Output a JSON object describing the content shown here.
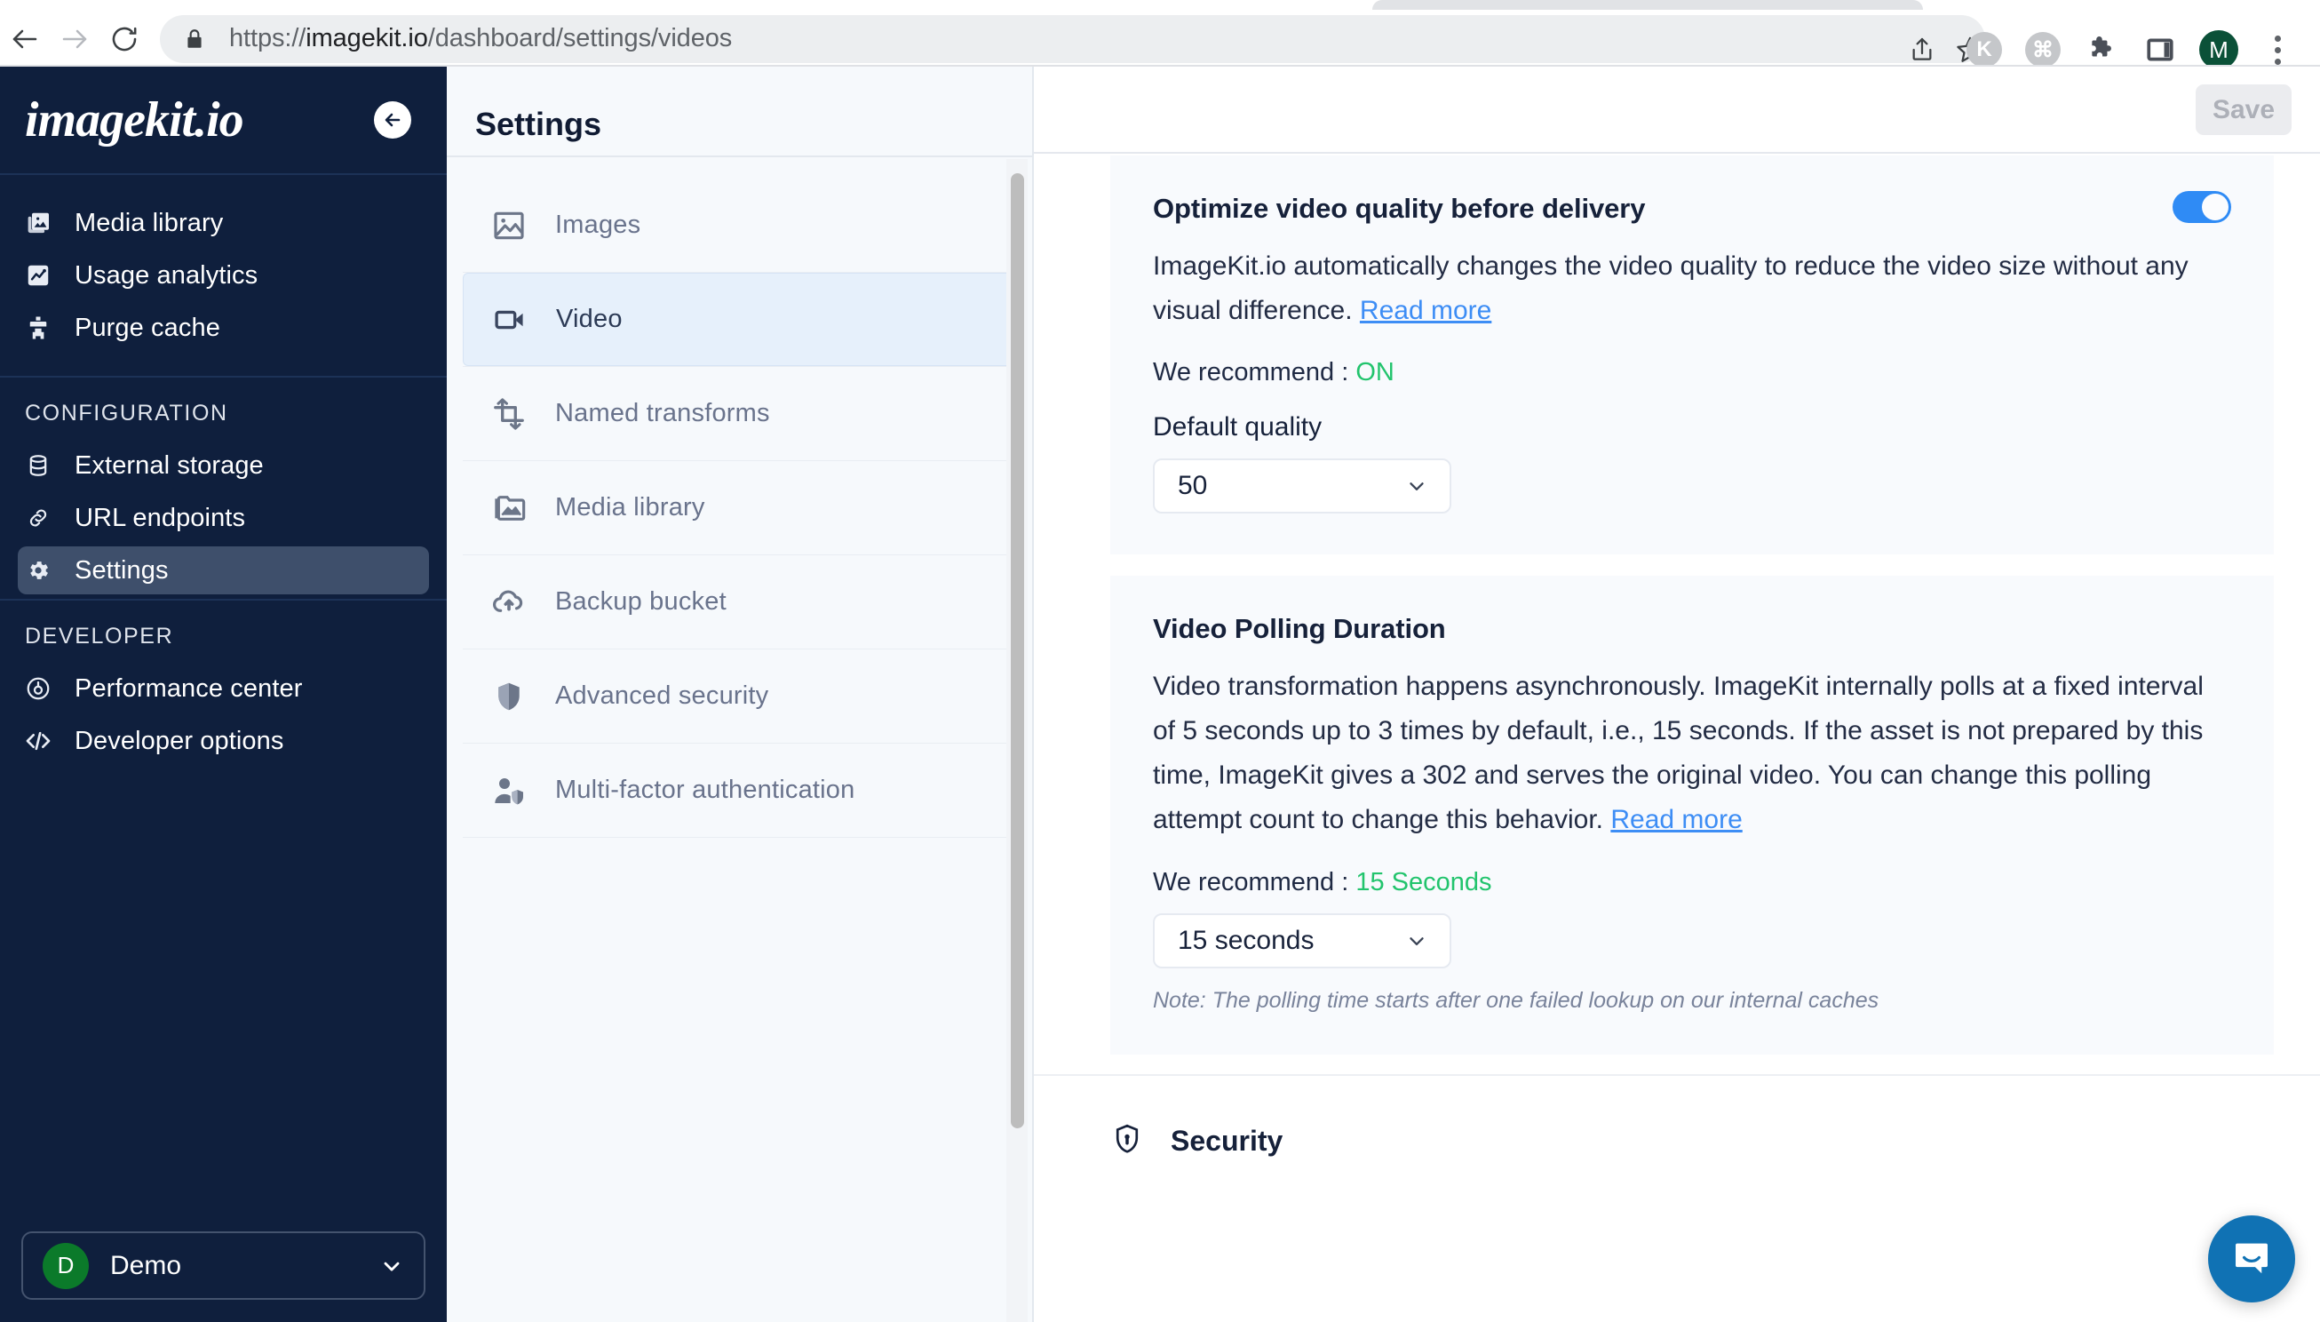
{
  "browser": {
    "back_label": "Back",
    "forward_label": "Forward",
    "reload_label": "Reload",
    "url_secure_part": "https://",
    "url_domain": "imagekit.io",
    "url_path": "/dashboard/settings/videos",
    "url_full": "https://imagekit.io/dashboard/settings/videos",
    "share_label": "Share",
    "bookmark_label": "Bookmark",
    "ext_k_label": "K",
    "ext_cmd_label": "⌘",
    "extensions_label": "Extensions",
    "side_panel_label": "Side panel",
    "profile_initial": "M",
    "menu_label": "Customize and control"
  },
  "sidebar": {
    "brand": "imagekit.io",
    "collapse_label": "Collapse sidebar",
    "primary_items": [
      {
        "label": "Media library",
        "icon": "media-library-icon"
      },
      {
        "label": "Usage analytics",
        "icon": "usage-analytics-icon"
      },
      {
        "label": "Purge cache",
        "icon": "purge-cache-icon"
      }
    ],
    "configuration_heading": "CONFIGURATION",
    "configuration_items": [
      {
        "label": "External storage",
        "icon": "database-icon"
      },
      {
        "label": "URL endpoints",
        "icon": "link-icon"
      },
      {
        "label": "Settings",
        "icon": "gear-icon",
        "active": true
      }
    ],
    "developer_heading": "DEVELOPER",
    "developer_items": [
      {
        "label": "Performance center",
        "icon": "gauge-icon"
      },
      {
        "label": "Developer options",
        "icon": "code-icon"
      }
    ],
    "account": {
      "initial": "D",
      "name": "Demo",
      "chevron": "chevron-down-icon"
    }
  },
  "settings_panel": {
    "title": "Settings",
    "items": [
      {
        "label": "Images",
        "icon": "image-icon",
        "selected": false
      },
      {
        "label": "Video",
        "icon": "video-camera-icon",
        "selected": true
      },
      {
        "label": "Named transforms",
        "icon": "crop-icon",
        "selected": false
      },
      {
        "label": "Media library",
        "icon": "folder-image-icon",
        "selected": false
      },
      {
        "label": "Backup bucket",
        "icon": "cloud-upload-icon",
        "selected": false
      },
      {
        "label": "Advanced security",
        "icon": "shield-icon",
        "selected": false
      },
      {
        "label": "Multi-factor authentication",
        "icon": "user-shield-icon",
        "selected": false
      }
    ]
  },
  "main": {
    "save_label": "Save",
    "optimize_card": {
      "title": "Optimize video quality before delivery",
      "body_text": "ImageKit.io automatically changes the video quality to reduce the video size without any visual difference.",
      "read_more": "Read more",
      "toggle_on": true,
      "recommend_prefix": "We recommend : ",
      "recommend_value": "ON",
      "field_label": "Default quality",
      "select_value": "50"
    },
    "polling_card": {
      "title": "Video Polling Duration",
      "body_text": "Video transformation happens asynchronously. ImageKit internally polls at a fixed interval of 5 seconds up to 3 times by default, i.e., 15 seconds. If the asset is not prepared by this time, ImageKit gives a 302 and serves the original video. You can change this polling attempt count to change this behavior.",
      "read_more": "Read more",
      "recommend_prefix": "We recommend : ",
      "recommend_value": "15 Seconds",
      "select_value": "15 seconds",
      "note": "Note: The polling time starts after one failed lookup on our internal caches"
    },
    "security_section": {
      "title": "Security",
      "icon": "lock-shield-icon"
    }
  },
  "chat": {
    "label": "Open chat"
  },
  "colors": {
    "sidebar_bg": "#0f1f3d",
    "accent_blue": "#2f8bf5",
    "link_blue": "#3d8df5",
    "recommend_green": "#22c46d",
    "card_bg": "#f8fafd",
    "panel_bg": "#f6f9fc",
    "chat_blue": "#1072b4",
    "avatar_green": "#0b7a2a"
  }
}
